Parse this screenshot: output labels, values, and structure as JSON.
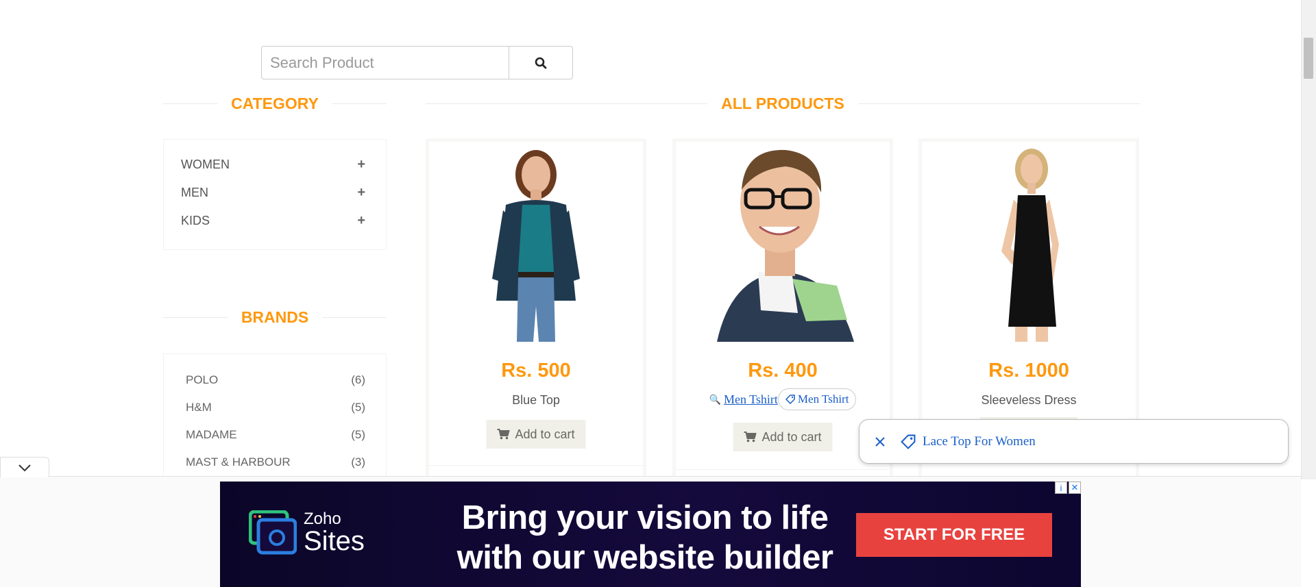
{
  "search": {
    "placeholder": "Search Product"
  },
  "category": {
    "title": "CATEGORY",
    "items": [
      {
        "label": "WOMEN"
      },
      {
        "label": "MEN"
      },
      {
        "label": "KIDS"
      }
    ]
  },
  "brands": {
    "title": "BRANDS",
    "items": [
      {
        "label": "POLO",
        "count": "(6)"
      },
      {
        "label": "H&M",
        "count": "(5)"
      },
      {
        "label": "MADAME",
        "count": "(5)"
      },
      {
        "label": "MAST & HARBOUR",
        "count": "(3)"
      }
    ]
  },
  "products": {
    "title": "ALL PRODUCTS",
    "add_to_cart": "Add to cart",
    "items": [
      {
        "price": "Rs. 500",
        "name": "Blue Top"
      },
      {
        "price": "Rs. 400",
        "name": "Men Tshirt",
        "chip": "Men Tshirt"
      },
      {
        "price": "Rs. 1000",
        "name": "Sleeveless Dress"
      }
    ]
  },
  "lens_popup": {
    "text": "Lace Top For Women"
  },
  "ad": {
    "brand_line1": "Zoho",
    "brand_line2": "Sites",
    "headline_1": "Bring your vision to life",
    "headline_2": "with our website builder",
    "cta": "START FOR FREE"
  },
  "colors": {
    "accent": "#fe980f",
    "cta": "#e8423f"
  }
}
